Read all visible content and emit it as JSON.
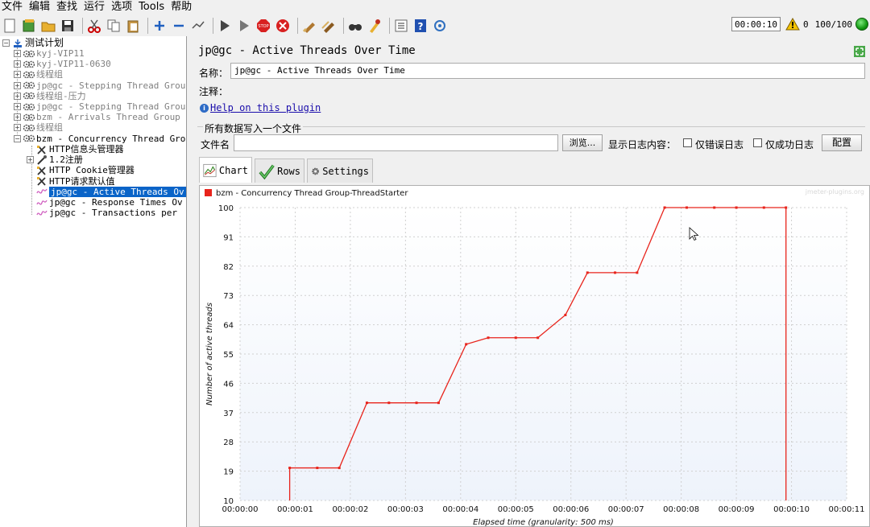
{
  "menubar": {
    "items": [
      "文件",
      "编辑",
      "查找",
      "运行",
      "选项",
      "Tools",
      "帮助"
    ]
  },
  "toolbar": {
    "icons": [
      "new-icon",
      "templates-icon",
      "open-icon",
      "save-icon",
      "cut-icon",
      "copy-icon",
      "paste-icon",
      "expand-all-icon",
      "collapse-all-icon",
      "toggle-icon",
      "start-icon",
      "start-no-pause-icon",
      "stop-icon",
      "shutdown-icon",
      "clear-icon",
      "clear-all-icon",
      "search-icon",
      "reset-search-icon",
      "function-helper-icon",
      "help-icon",
      "remote-icon"
    ],
    "timer": "00:00:10",
    "warnings": "0",
    "threads": "100/100"
  },
  "tree": {
    "root": "测试计划",
    "nodes": [
      {
        "label": "kyj-VIP11",
        "dim": true,
        "icon": "thread-group-icon"
      },
      {
        "label": "kyj-VIP11-0630",
        "dim": true,
        "icon": "thread-group-icon"
      },
      {
        "label": "线程组",
        "dim": true,
        "icon": "thread-group-icon"
      },
      {
        "label": "jp@gc - Stepping Thread Grou",
        "dim": true,
        "icon": "thread-group-icon"
      },
      {
        "label": "线程组-压力",
        "dim": true,
        "icon": "thread-group-icon"
      },
      {
        "label": "jp@gc - Stepping Thread Grou",
        "dim": true,
        "icon": "thread-group-icon"
      },
      {
        "label": "bzm - Arrivals Thread Group",
        "dim": true,
        "icon": "thread-group-icon"
      },
      {
        "label": "线程组",
        "dim": true,
        "icon": "thread-group-icon"
      },
      {
        "label": "bzm - Concurrency Thread Gro",
        "dim": false,
        "icon": "thread-group-icon"
      }
    ],
    "children": [
      {
        "label": "HTTP信息头管理器",
        "icon": "config-tool-icon"
      },
      {
        "label": "1.2注册",
        "icon": "sampler-icon"
      },
      {
        "label": "HTTP Cookie管理器",
        "icon": "config-tool-icon"
      },
      {
        "label": "HTTP请求默认值",
        "icon": "config-tool-icon"
      },
      {
        "label": "jp@gc - Active Threads Ov",
        "icon": "listener-icon",
        "selected": true
      },
      {
        "label": "jp@gc - Response Times Ov",
        "icon": "listener-icon"
      },
      {
        "label": "jp@gc - Transactions per",
        "icon": "listener-icon"
      }
    ]
  },
  "panel": {
    "title": "jp@gc - Active Threads Over Time",
    "name_label": "名称：",
    "name_value": "jp@gc - Active Threads Over Time",
    "comment_label": "注释：",
    "help_link": "Help on this plugin",
    "file_section_title": "所有数据写入一个文件",
    "file_label": "文件名",
    "browse_label": "浏览...",
    "log_label": "显示日志内容：",
    "errors_only_label": "仅错误日志",
    "success_only_label": "仅成功日志",
    "config_label": "配置"
  },
  "tabs": [
    {
      "label": "Chart",
      "icon": "chart-tab-icon",
      "active": true
    },
    {
      "label": "Rows",
      "icon": "rows-tab-icon",
      "active": false
    },
    {
      "label": "Settings",
      "icon": "settings-tab-icon",
      "active": false
    }
  ],
  "chart_data": {
    "type": "line",
    "watermark": "jmeter-plugins.org",
    "series": [
      {
        "name": "bzm - Concurrency Thread Group-ThreadStarter",
        "color": "#e8241c",
        "x": [
          "00:00:00.9",
          "00:00:01.4",
          "00:00:01.8",
          "00:00:02.3",
          "00:00:02.7",
          "00:00:03.2",
          "00:00:03.6",
          "00:00:04.1",
          "00:00:04.5",
          "00:00:05.0",
          "00:00:05.4",
          "00:00:05.9",
          "00:00:06.3",
          "00:00:06.8",
          "00:00:07.2",
          "00:00:07.7",
          "00:00:08.1",
          "00:00:08.6",
          "00:00:09.0",
          "00:00:09.5",
          "00:00:09.9"
        ],
        "values": [
          20,
          20,
          20,
          40,
          40,
          40,
          40,
          58,
          60,
          60,
          60,
          67,
          80,
          80,
          80,
          100,
          100,
          100,
          100,
          100,
          100
        ]
      }
    ],
    "xlabel": "Elapsed time (granularity: 500 ms)",
    "ylabel": "Number of active threads",
    "x_ticks": [
      "00:00:00",
      "00:00:01",
      "00:00:02",
      "00:00:03",
      "00:00:04",
      "00:00:05",
      "00:00:06",
      "00:00:07",
      "00:00:08",
      "00:00:09",
      "00:00:10",
      "00:00:11"
    ],
    "y_ticks": [
      10,
      19,
      28,
      37,
      46,
      55,
      64,
      73,
      82,
      91,
      100
    ],
    "xlim": [
      "00:00:00",
      "00:00:11"
    ],
    "ylim": [
      10,
      100
    ],
    "grid": true,
    "legend_position": "top-left"
  }
}
